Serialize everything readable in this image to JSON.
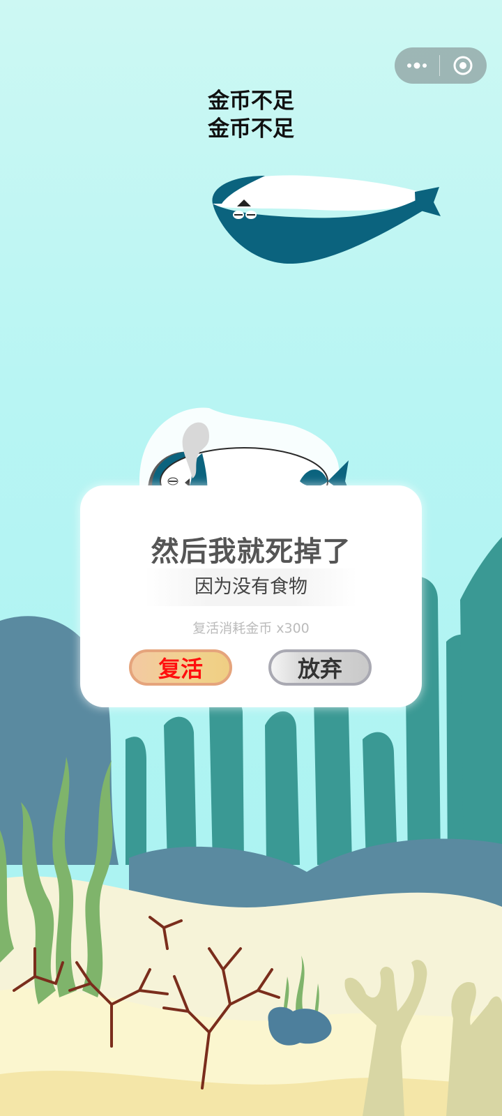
{
  "capsule": {
    "menu_icon": "more-dots-icon",
    "close_icon": "target-circle-icon"
  },
  "toast": {
    "line1": "金币不足",
    "line2": "金币不足"
  },
  "dialog": {
    "title": "然后我就死掉了",
    "subtitle": "因为没有食物",
    "cost_text": "复活消耗金币  x300",
    "revive_label": "复活",
    "give_up_label": "放弃"
  },
  "colors": {
    "sky_top": "#c8f7f4",
    "sky_bottom": "#a9f3f2",
    "fish": "#0b637e",
    "revive_text": "#ff0e0e"
  }
}
